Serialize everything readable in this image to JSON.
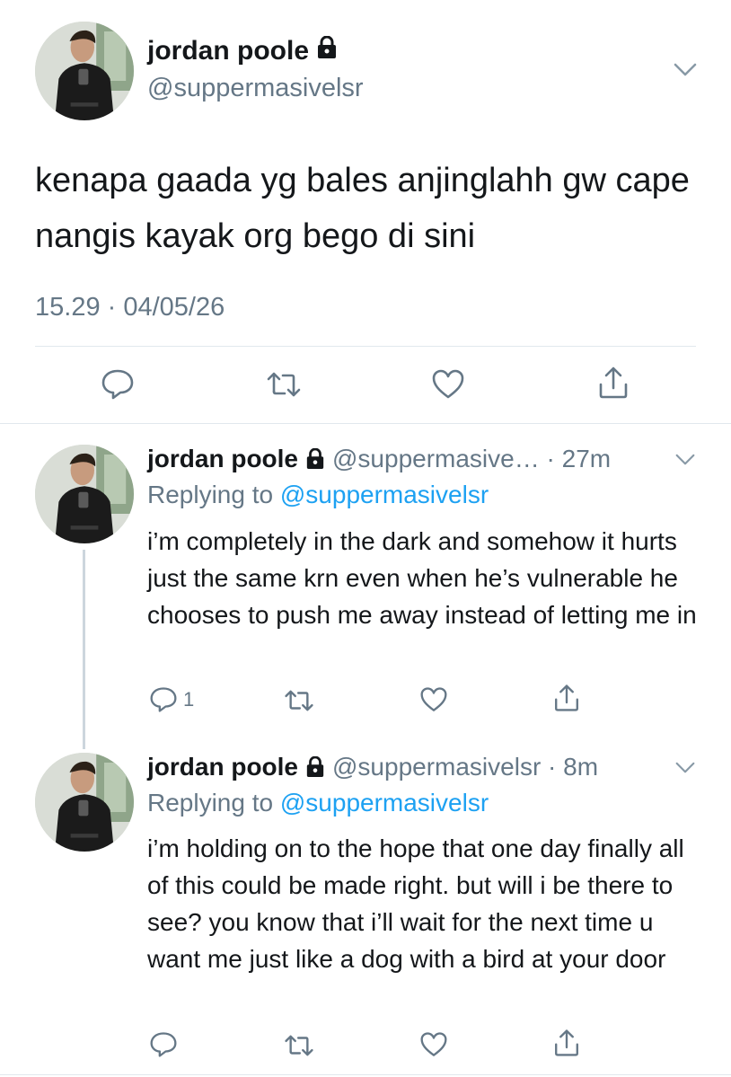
{
  "main_tweet": {
    "name": "jordan poole",
    "handle": "@suppermasivelsr",
    "text": "kenapa gaada yg bales anjinglahh gw cape nangis kayak org bego di sini",
    "timestamp": "15.29 · 04/05/26",
    "icons": [
      "lock-icon",
      "chevron-down-icon",
      "reply-icon",
      "retweet-icon",
      "like-icon",
      "share-icon"
    ]
  },
  "replies": [
    {
      "name": "jordan poole",
      "handle": "@suppermasive…",
      "separator": " · ",
      "time": "27m",
      "replying_prefix": "Replying to ",
      "replying_to": "@suppermasivelsr",
      "text": "i’m completely in the dark and somehow it hurts just the same krn even when he’s vulnerable he chooses to push me away instead of letting me in",
      "reply_count": "1"
    },
    {
      "name": "jordan poole",
      "handle": "@suppermasivelsr",
      "separator": " · ",
      "time": "8m",
      "replying_prefix": "Replying to ",
      "replying_to": "@suppermasivelsr",
      "text": "i’m holding on to the hope that one day finally all of this could be made right. but will i be there to see? you know that i’ll wait for the next time u want me just like a dog with a bird at your door",
      "reply_count": ""
    }
  ],
  "colors": {
    "text": "#14171a",
    "secondary": "#657786",
    "link": "#1da1f2",
    "divider": "#e1e8ed",
    "thread_line": "#ccd6dd"
  }
}
